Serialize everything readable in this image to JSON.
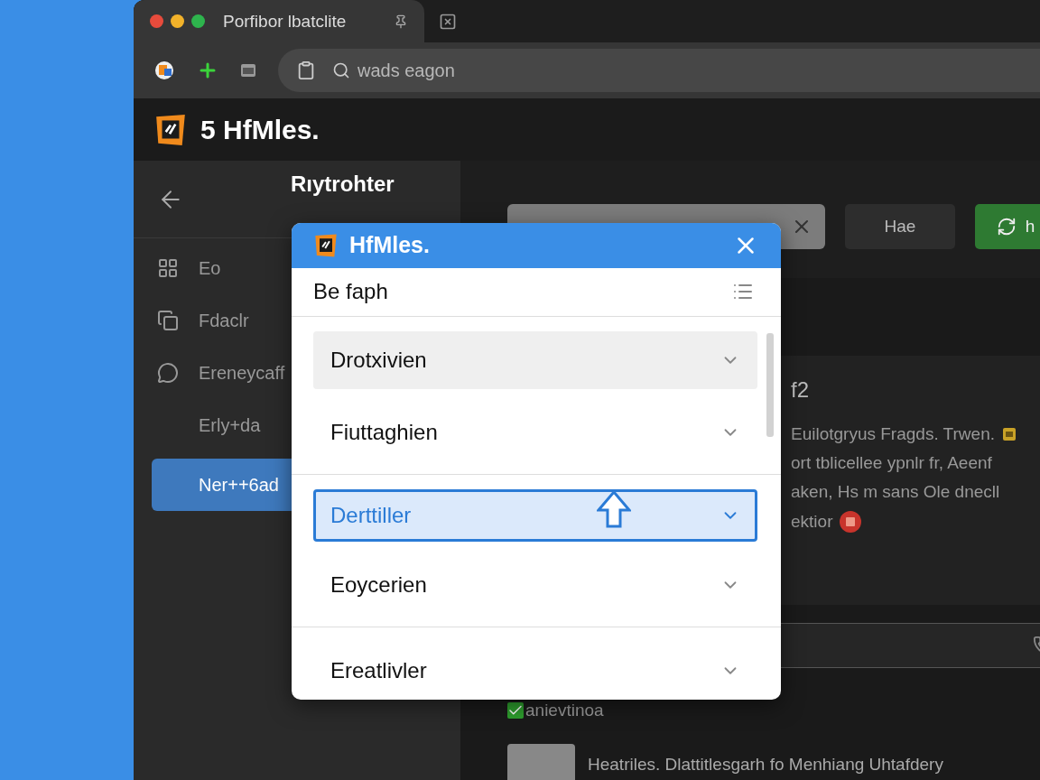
{
  "window": {
    "tab_title": "Porfibor lbatclite"
  },
  "address_bar": {
    "placeholder": "wads eagon"
  },
  "app_header": {
    "title": "5 HfMles."
  },
  "sidebar": {
    "title": "Rıytrohter",
    "items": [
      {
        "label": "Eo",
        "selected": false
      },
      {
        "label": "Fdaclr",
        "selected": false
      },
      {
        "label": "Ereneycaff",
        "selected": false
      },
      {
        "label": "Erly+da",
        "selected": false
      },
      {
        "label": "Ner++6ad",
        "selected": true
      }
    ]
  },
  "toolbar": {
    "buttons": [
      {
        "label": "Hae",
        "kind": "plain"
      },
      {
        "label": "h",
        "kind": "primary"
      }
    ]
  },
  "card": {
    "heading": "f2",
    "lines": [
      "Euilotgryus Fragds. Trwen.",
      "ort tblicellee ypnlr fr, Aeenf",
      "aken, Hs m sans Ole dnecll",
      "ektior"
    ]
  },
  "section": {
    "label": "anievtinoa",
    "item_text": "Heatriles. Dlattitlesgarh fo Menhiang Uhtafdery"
  },
  "dialog": {
    "title": "HfMles.",
    "subtitle": "Be faph",
    "items": [
      {
        "label": "Drotxivien",
        "selected": false,
        "hovered": true
      },
      {
        "label": "Fiuttaghien",
        "selected": false,
        "hovered": false
      },
      {
        "label": "Derttiller",
        "selected": true,
        "hovered": false
      },
      {
        "label": "Eoycerien",
        "selected": false,
        "hovered": false
      },
      {
        "label": "Ereatlivler",
        "selected": false,
        "hovered": false
      }
    ]
  }
}
